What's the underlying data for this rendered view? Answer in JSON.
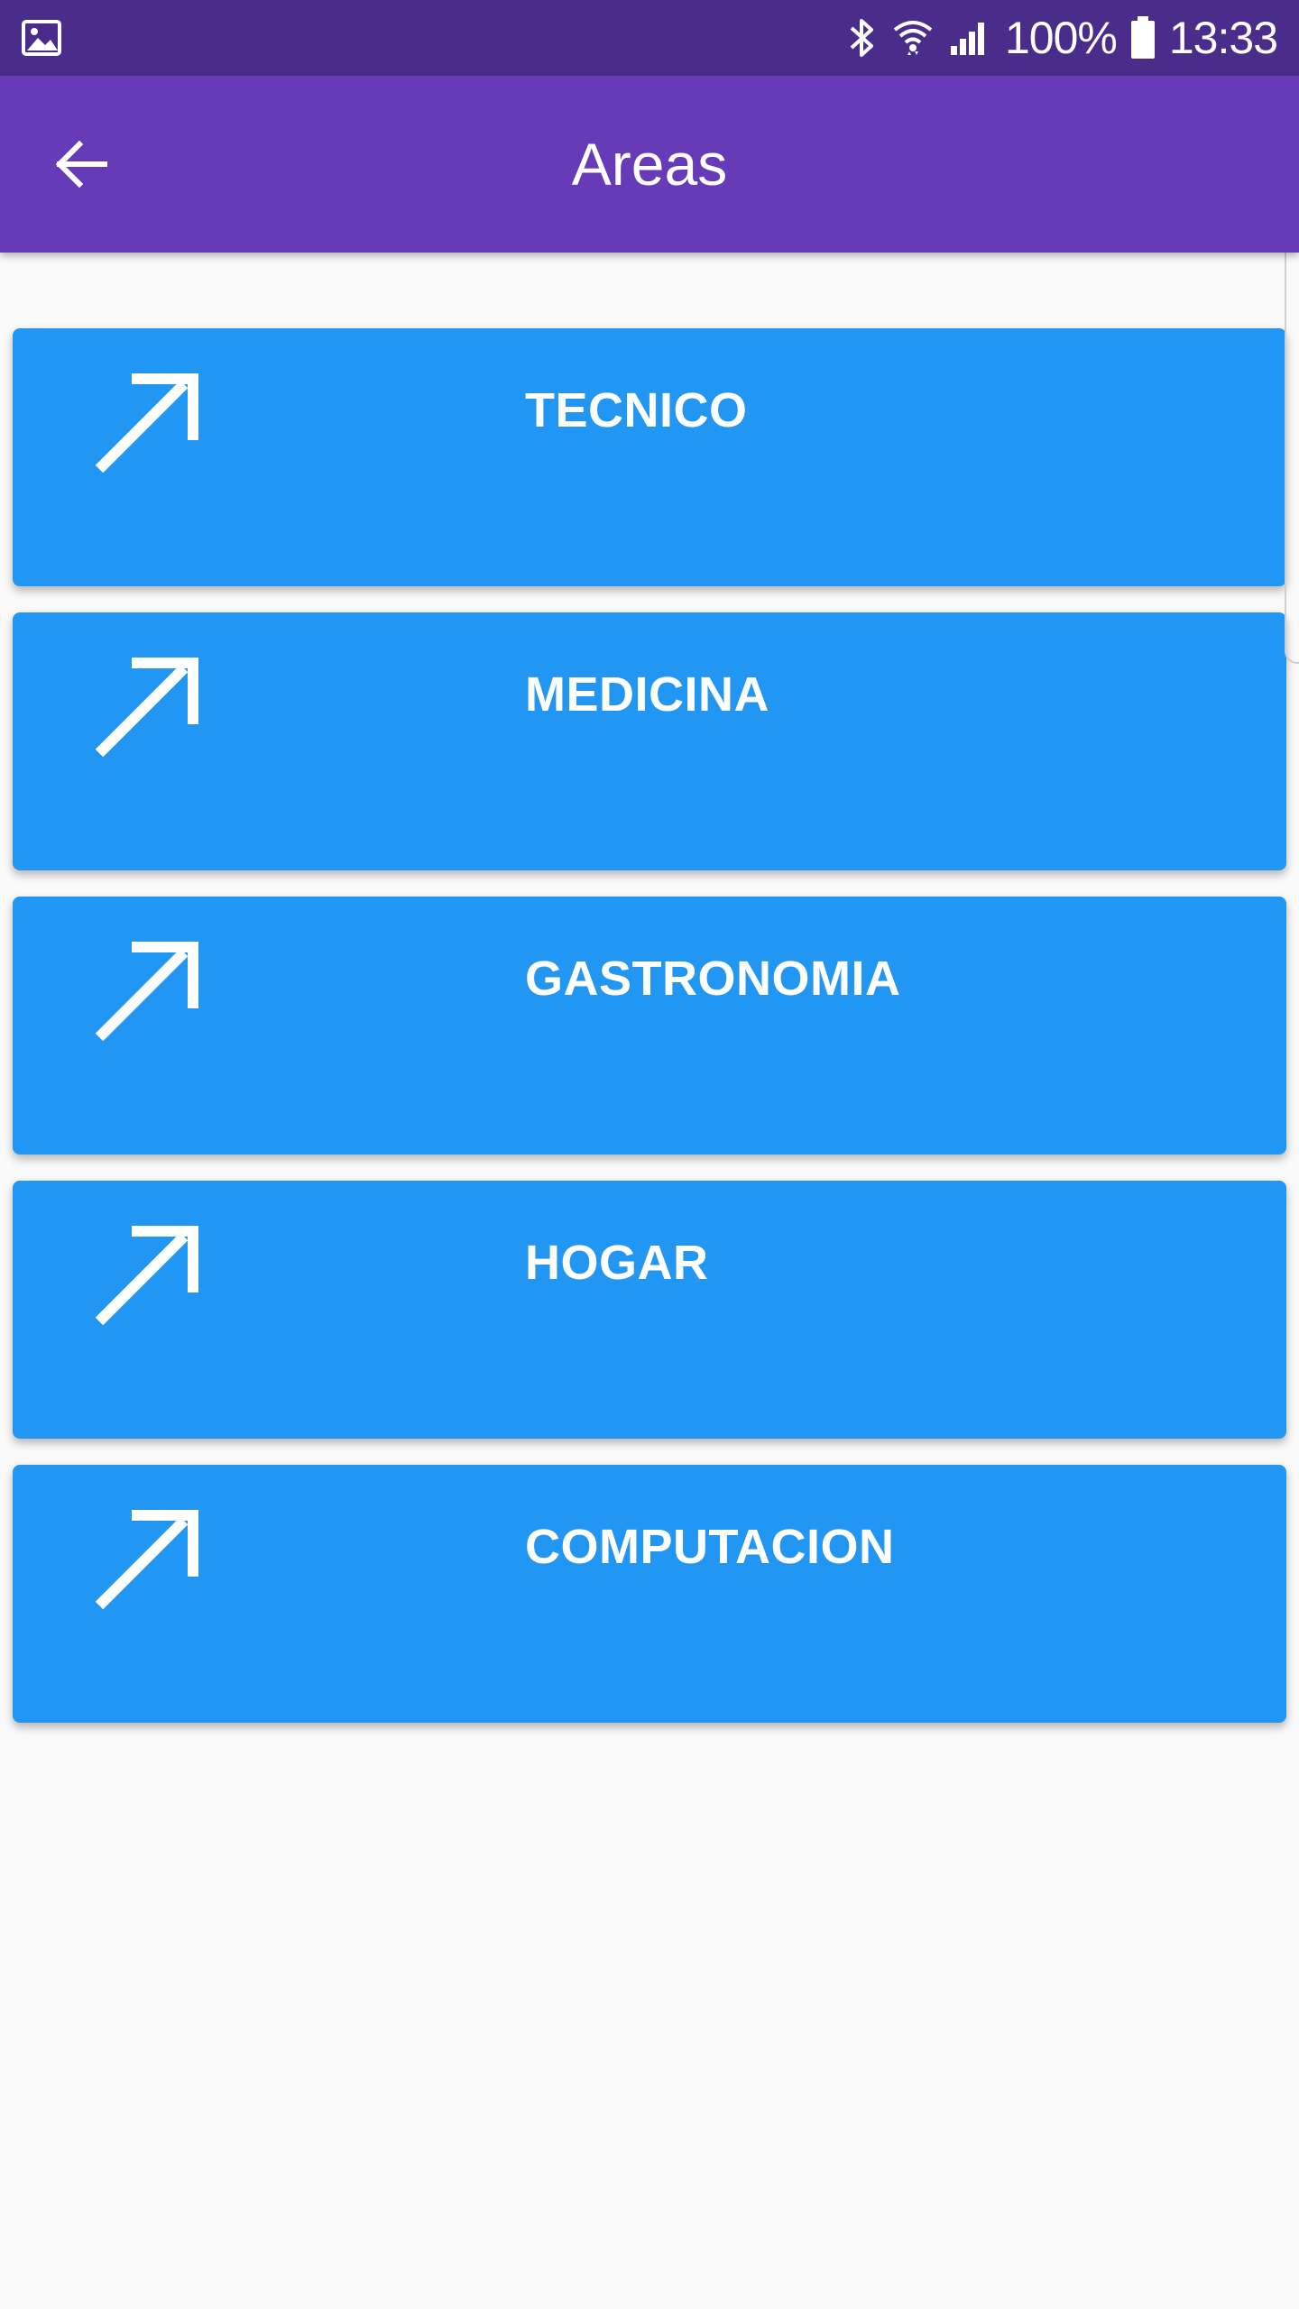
{
  "status_bar": {
    "battery": "100%",
    "time": "13:33",
    "icons": [
      "gallery-icon",
      "bluetooth-icon",
      "wifi-icon",
      "signal-icon",
      "battery-icon"
    ]
  },
  "app_bar": {
    "title": "Areas",
    "back_icon": "arrow-back-icon"
  },
  "areas": [
    {
      "label": "TECNICO",
      "icon": "arrow-up-right-icon"
    },
    {
      "label": "MEDICINA",
      "icon": "arrow-up-right-icon"
    },
    {
      "label": "GASTRONOMIA",
      "icon": "arrow-up-right-icon"
    },
    {
      "label": "HOGAR",
      "icon": "arrow-up-right-icon"
    },
    {
      "label": "COMPUTACION",
      "icon": "arrow-up-right-icon"
    }
  ],
  "colors": {
    "status_bar": "#4a2c8a",
    "app_bar": "#673ab7",
    "card": "#2196f3",
    "background": "#fafafa",
    "text": "#ffffff"
  }
}
